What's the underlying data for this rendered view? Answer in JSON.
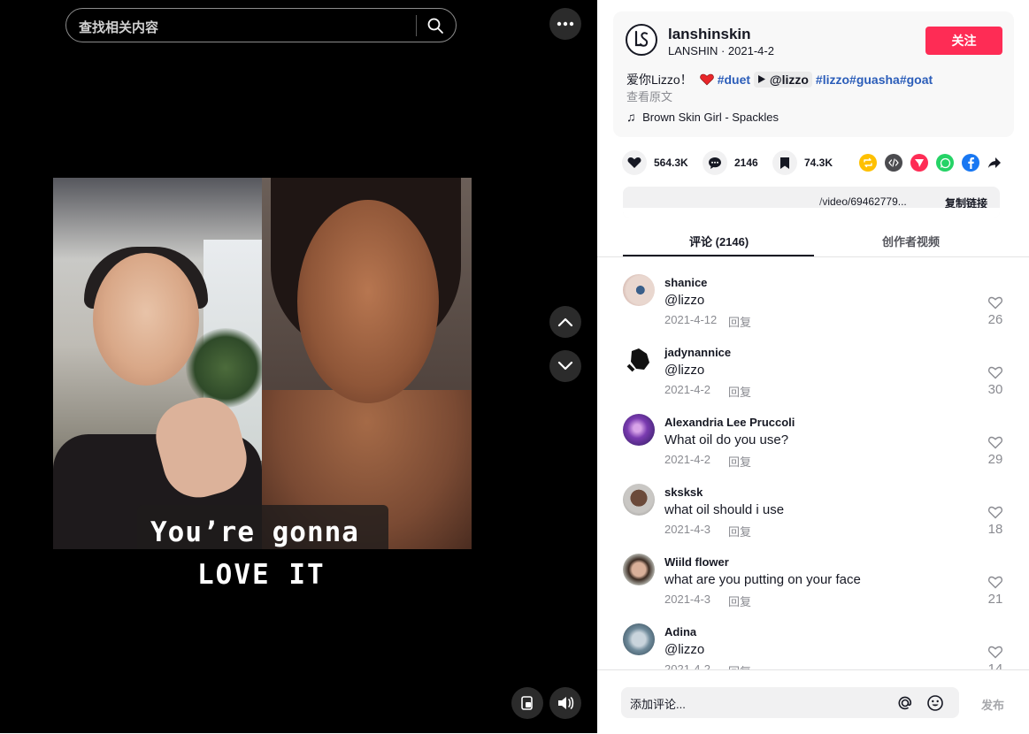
{
  "search": {
    "placeholder": "查找相关内容"
  },
  "video": {
    "caption_line1": "You’re gonna",
    "caption_line2": "LOVE IT"
  },
  "post": {
    "author_handle": "lanshinskin",
    "author_name": "LANSHIN",
    "date": "2021-4-2",
    "author_sub": "LANSHIN · 2021-4-2",
    "follow_label": "关注",
    "desc_text": "爱你Lizzo！",
    "tags": [
      "#duet",
      "@lizzo",
      "#lizzo",
      "#guasha",
      "#goat"
    ],
    "see_original": "查看原文",
    "music": "Brown Skin Girl - Spackles"
  },
  "actions": {
    "likes": "564.3K",
    "comments": "2146",
    "bookmarks": "74.3K"
  },
  "link": {
    "url_fragment": "/video/69462779...",
    "copy_label": "复制链接"
  },
  "tabs": [
    {
      "label": "评论 (2146)"
    },
    {
      "label": "创作者视频"
    }
  ],
  "comments": [
    {
      "user": "shanice",
      "text": "@lizzo",
      "date": "2021-4-12",
      "reply": "回复",
      "likes": "26"
    },
    {
      "user": "jadynannice",
      "text": "@lizzo",
      "date": "2021-4-2",
      "reply": "回复",
      "likes": "30"
    },
    {
      "user": "Alexandria Lee Pruccoli",
      "text": "What oil do you use?",
      "date": "2021-4-2",
      "reply": "回复",
      "likes": "29"
    },
    {
      "user": "sksksk",
      "text": "what oil should i use",
      "date": "2021-4-3",
      "reply": "回复",
      "likes": "18"
    },
    {
      "user": "Wiild flower",
      "text": "what are you putting on your face",
      "date": "2021-4-3",
      "reply": "回复",
      "likes": "21"
    },
    {
      "user": "Adina",
      "text": "@lizzo",
      "date": "2021-4-2",
      "reply": "回复",
      "likes": "14"
    }
  ],
  "comment_box": {
    "placeholder": "添加评论...",
    "post_label": "发布"
  },
  "colors": {
    "accent": "#fe2c55",
    "tag": "#2b5db9"
  }
}
